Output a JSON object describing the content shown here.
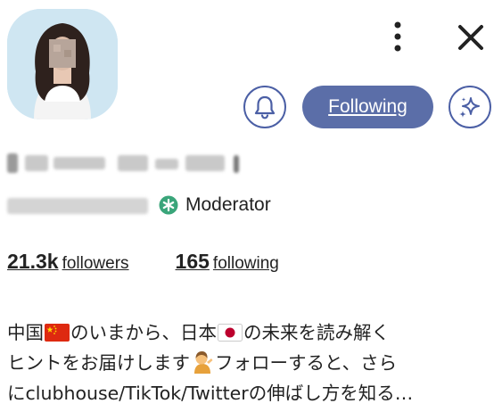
{
  "profile": {
    "moderator_label": "Moderator"
  },
  "stats": {
    "followers_count": "21.3k",
    "followers_label": "followers",
    "following_count": "165",
    "following_label": "following"
  },
  "actions": {
    "following_label": "Following"
  },
  "bio": {
    "line1_a": "中国",
    "line1_b": "のいまから、日本",
    "line1_c": "の未来を読み解く",
    "line2_a": "ヒントをお届けします",
    "line2_b": "フォローすると、さら",
    "line3": "にclubhouse/TikTok/Twitterの伸ばし方を知る…"
  },
  "icons": {
    "more": "more-vertical-icon",
    "close": "close-icon",
    "bell": "bell-icon",
    "sparkle": "sparkle-icon",
    "moderator": "moderator-star-icon",
    "china_flag": "china-flag-icon",
    "japan_flag": "japan-flag-icon",
    "tipping_hand": "tipping-hand-emoji-icon"
  },
  "colors": {
    "accent": "#5b6ea8",
    "accent_outline": "#4b5fa5",
    "moderator_green": "#3aa57a",
    "avatar_bg": "#cfe6f2"
  }
}
